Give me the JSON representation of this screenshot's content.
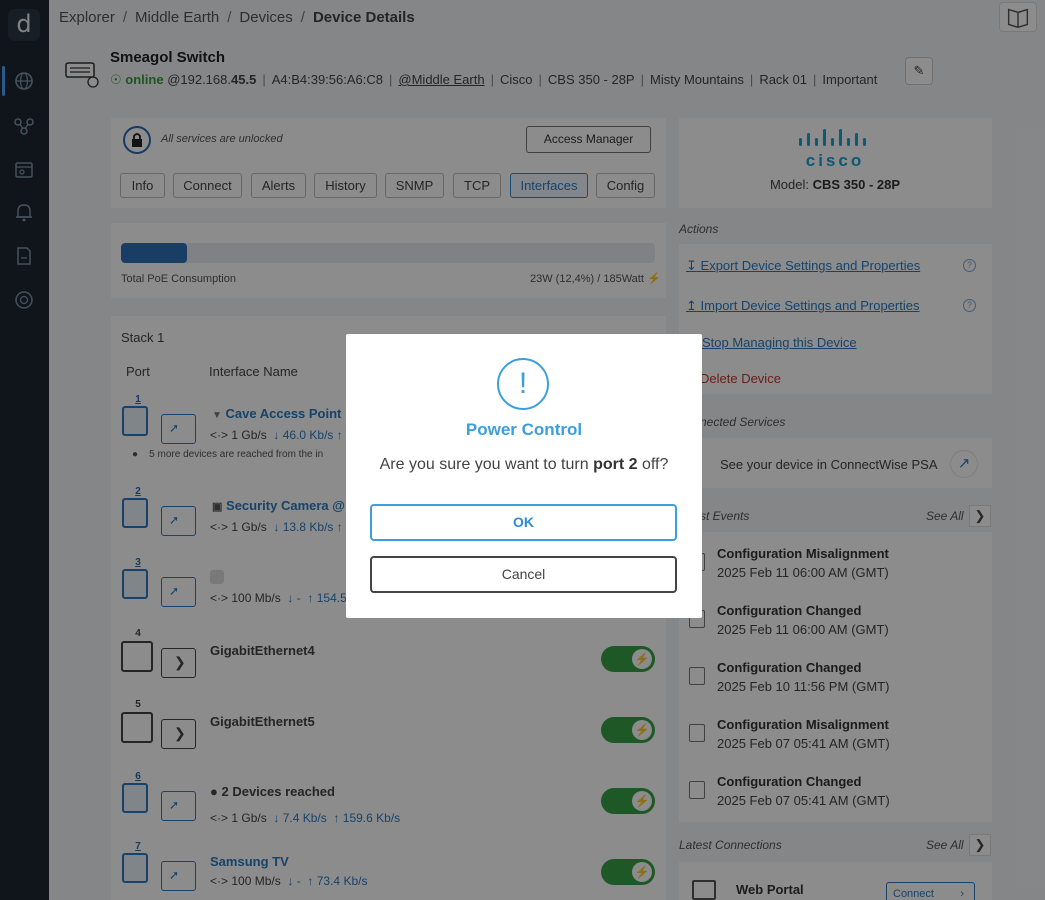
{
  "breadcrumb": [
    "Explorer",
    "Middle Earth",
    "Devices",
    "Device Details"
  ],
  "device": {
    "name": "Smeagol Switch",
    "status": "online",
    "ip_prefix": "@192.168.",
    "ip_suffix": "45.5",
    "mac": "A4:B4:39:56:A6:C8",
    "site": "@Middle Earth",
    "vendor": "Cisco",
    "model": "CBS 350 - 28P",
    "location": "Misty Mountains",
    "rack": "Rack 01",
    "importance": "Important"
  },
  "services": {
    "unlocked_text": "All services are unlocked",
    "access_manager": "Access Manager"
  },
  "tabs": [
    "Info",
    "Connect",
    "Alerts",
    "History",
    "SNMP",
    "TCP",
    "Interfaces",
    "Config"
  ],
  "active_tab": "Interfaces",
  "poe": {
    "label": "Total PoE Consumption",
    "value": "23W (12,4%) / 185Watt",
    "fraction": 0.124
  },
  "stack": {
    "title": "Stack 1",
    "col_port": "Port",
    "col_interface": "Interface Name",
    "ports": [
      {
        "num": "1",
        "name": "Cave Access Point",
        "link": "1 Gb/s",
        "down": "46.0 Kb/s",
        "note": "5 more devices are reached from the in"
      },
      {
        "num": "2",
        "name": "Security Camera",
        "name_suffix": "@",
        "link": "1 Gb/s",
        "down": "13.8 Kb/s"
      },
      {
        "num": "3",
        "link": "100 Mb/s",
        "down": "-",
        "up": "154.5"
      },
      {
        "num": "4",
        "name": "GigabitEthernet4"
      },
      {
        "num": "5",
        "name": "GigabitEthernet5"
      },
      {
        "num": "6",
        "name": "2 Devices reached",
        "link": "1 Gb/s",
        "down": "7.4 Kb/s",
        "up": "159.6 Kb/s"
      },
      {
        "num": "7",
        "name": "Samsung TV",
        "link": "100 Mb/s",
        "down": "-",
        "up": "73.4 Kb/s"
      }
    ]
  },
  "model_panel": {
    "label": "Model: ",
    "value": "CBS 350 - 28P"
  },
  "actions": {
    "title": "Actions",
    "export": "Export Device Settings and Properties",
    "import": "Import Device Settings and Properties",
    "stop": "Stop Managing this Device",
    "delete": "Delete Device"
  },
  "connected_services": {
    "title": "nected Services",
    "connectwise": "See your device in ConnectWise PSA"
  },
  "events": {
    "title": "st Events",
    "see_all": "See All",
    "items": [
      {
        "title": "Configuration Misalignment",
        "date": "2025 Feb 11 06:00 AM (GMT)"
      },
      {
        "title": "Configuration Changed",
        "date": "2025 Feb 11 06:00 AM (GMT)"
      },
      {
        "title": "Configuration Changed",
        "date": "2025 Feb 10 11:56 PM (GMT)"
      },
      {
        "title": "Configuration Misalignment",
        "date": "2025 Feb 07 05:41 AM (GMT)"
      },
      {
        "title": "Configuration Changed",
        "date": "2025 Feb 07 05:41 AM (GMT)"
      }
    ]
  },
  "connections": {
    "title": "Latest Connections",
    "see_all": "See All",
    "item": "Web Portal",
    "button": "Connect"
  },
  "modal": {
    "icon": "!",
    "title": "Power Control",
    "msg_pre": "Are you sure you want to turn ",
    "msg_port": "port 2",
    "msg_post": " off?",
    "ok": "OK",
    "cancel": "Cancel"
  },
  "colors": {
    "accent": "#2d7ac0",
    "online": "#3a9b3a",
    "toggle": "#3aa047",
    "modal_accent": "#3a9fdd"
  }
}
